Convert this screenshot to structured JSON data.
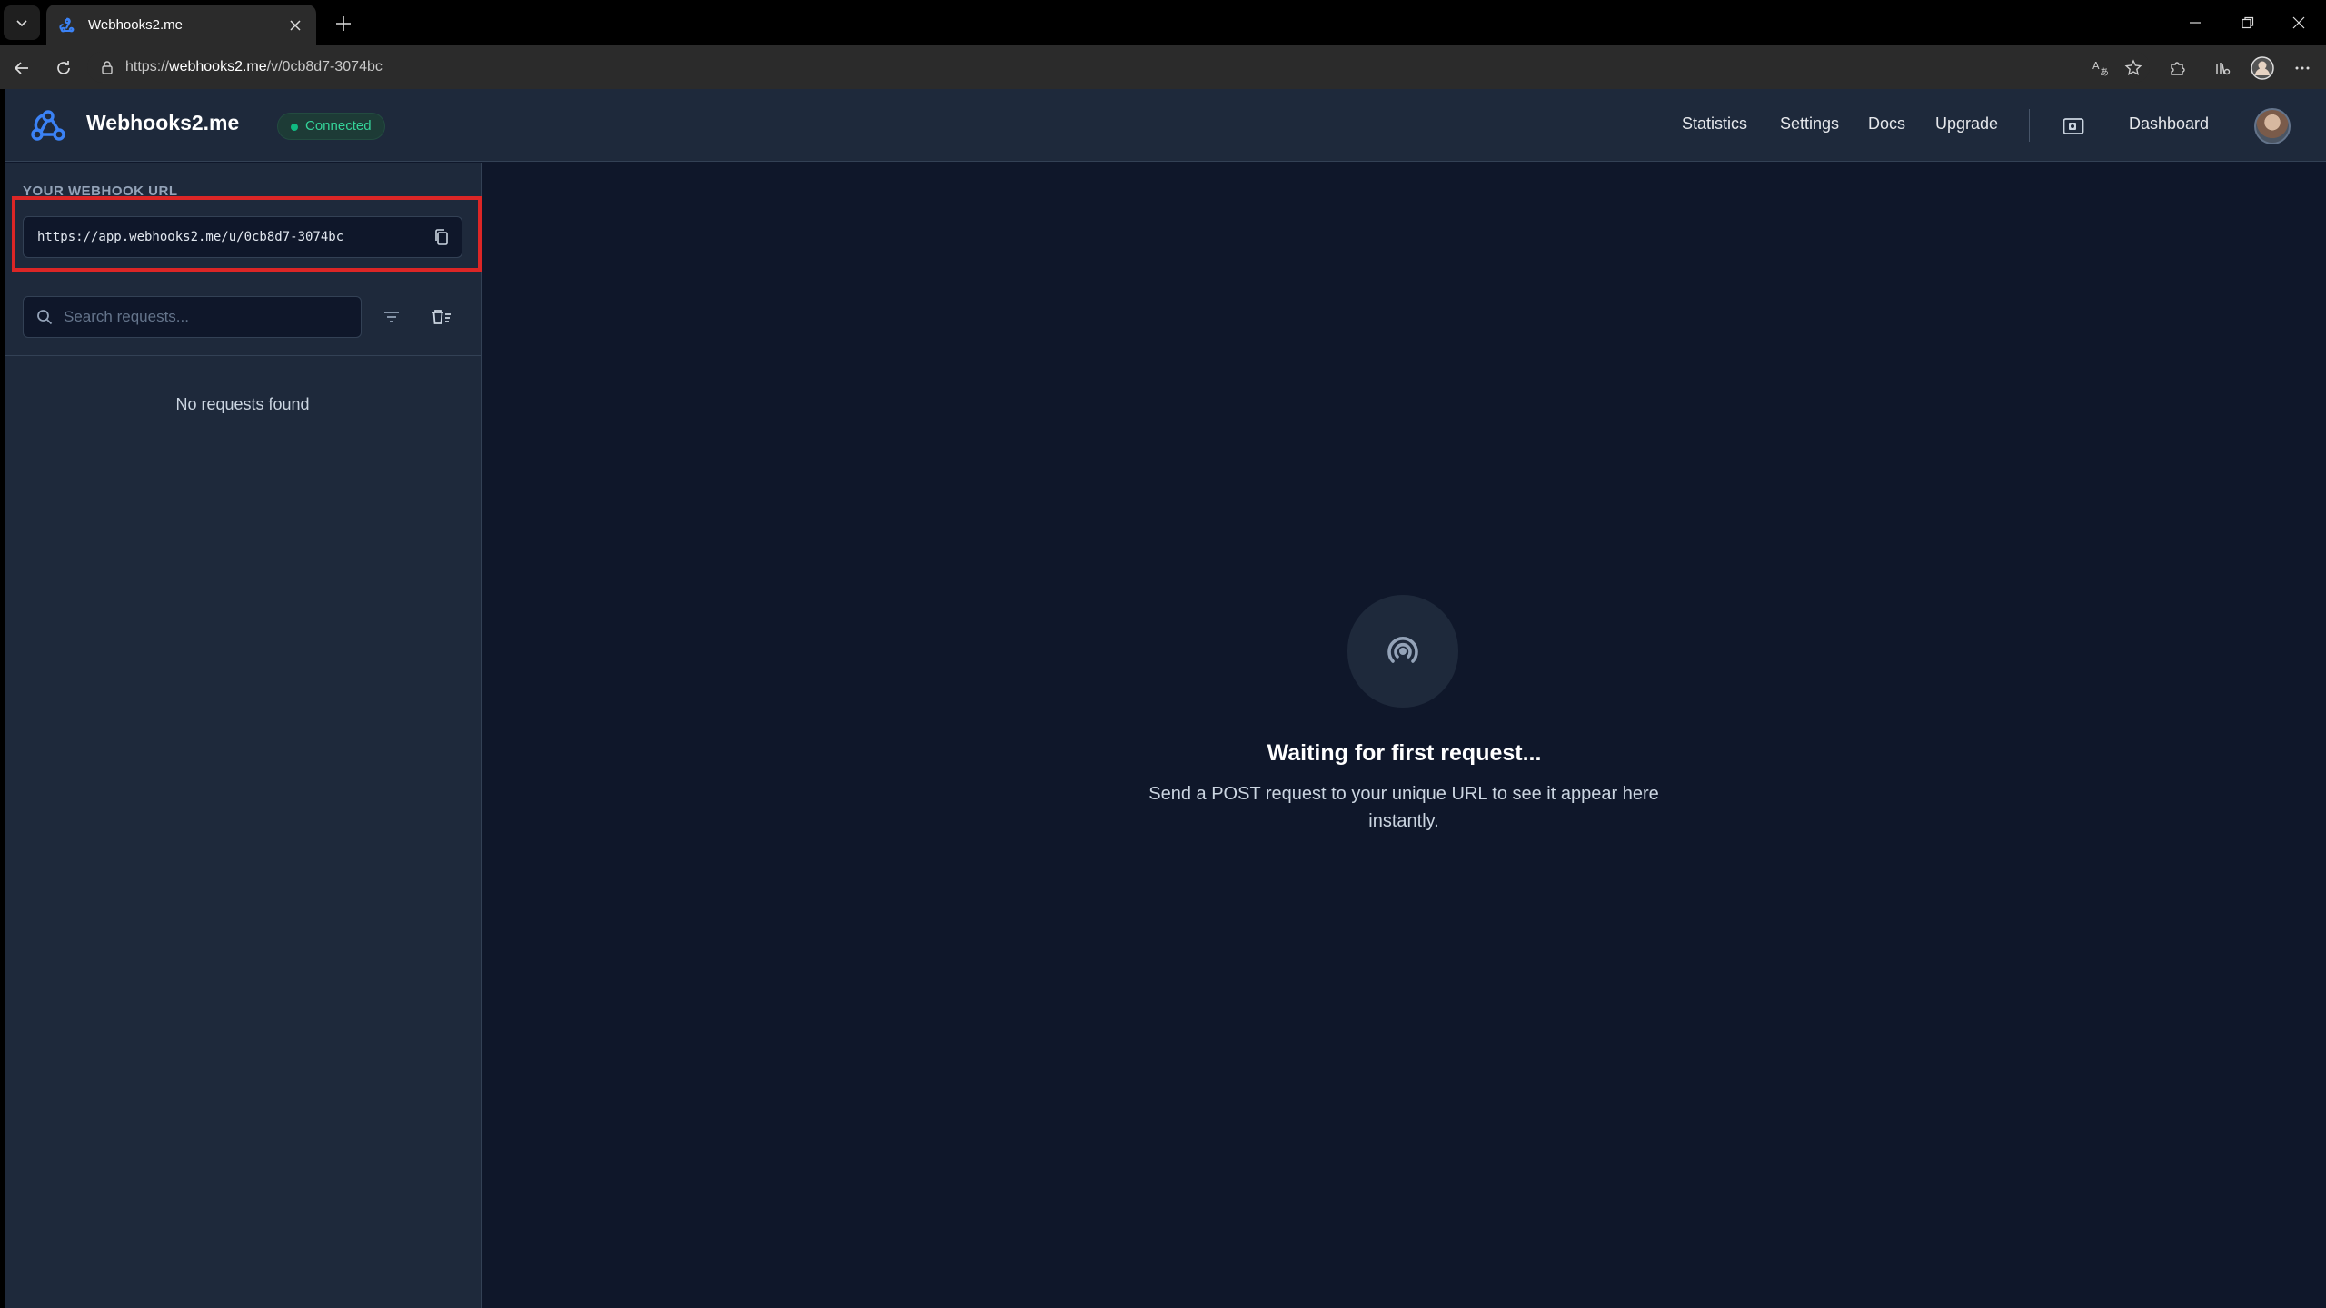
{
  "browser": {
    "tab_title": "Webhooks2.me",
    "url_prefix": "https://",
    "url_host": "webhooks2.me",
    "url_path": "/v/0cb8d7-3074bc"
  },
  "navbar": {
    "brand": "Webhooks2.me",
    "status": "Connected",
    "links": {
      "statistics": "Statistics",
      "settings": "Settings",
      "docs": "Docs",
      "upgrade": "Upgrade",
      "dashboard": "Dashboard"
    }
  },
  "sidebar": {
    "webhook_label": "YOUR WEBHOOK URL",
    "webhook_url": "https://app.webhooks2.me/u/0cb8d7-3074bc",
    "search_placeholder": "Search requests...",
    "empty_text": "No requests found"
  },
  "main": {
    "title": "Waiting for first request...",
    "description": "Send a POST request to your unique URL to see it appear here instantly."
  },
  "colors": {
    "background": "#0f172a",
    "panel": "#1e293b",
    "accent": "#3b82f6",
    "connected": "#10b981",
    "highlight": "#dc2626"
  }
}
